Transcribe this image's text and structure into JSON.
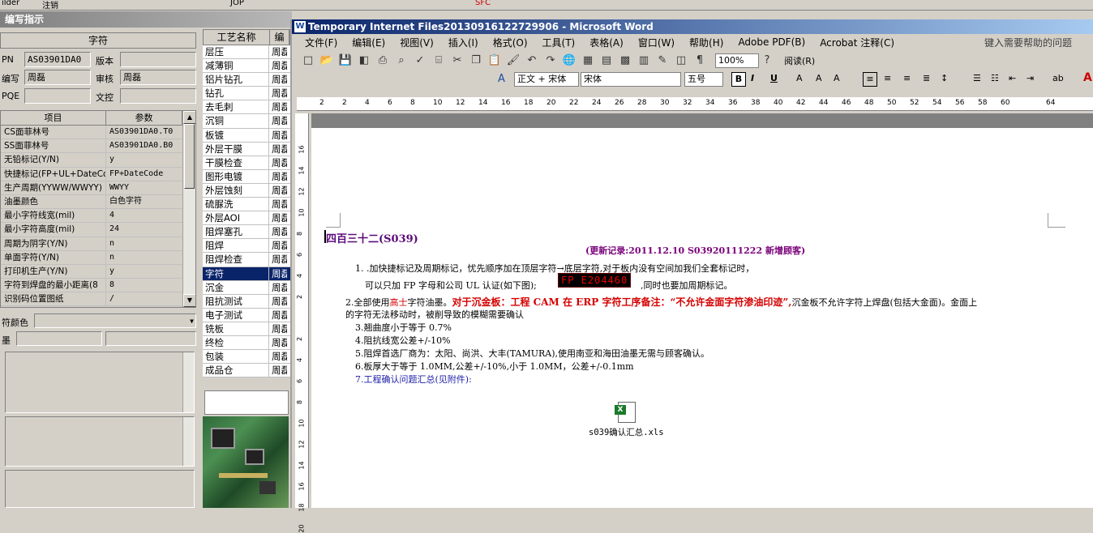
{
  "top_strip": {
    "left_label": "ilder",
    "cancel_label": "注销",
    "jop": "JOP",
    "sfc": "SFC"
  },
  "left_window": {
    "title": "编写指示",
    "section_title": "字符",
    "fields": {
      "pn_label": "PN",
      "pn_value": "AS03901DA0",
      "version_label": "版本",
      "version_value": "",
      "writer_label": "编写",
      "writer_value": "周磊",
      "review_label": "审核",
      "review_value": "周磊",
      "pqe_label": "PQE",
      "pqe_value": "",
      "doc_control_label": "文控",
      "doc_control_value": ""
    },
    "param_table": {
      "headers": [
        "项目",
        "参数"
      ],
      "rows": [
        {
          "item": "CS面菲林号",
          "value": "AS03901DA0.T0"
        },
        {
          "item": "SS面菲林号",
          "value": "AS03901DA0.B0"
        },
        {
          "item": "无铅标记(Y/N)",
          "value": "y"
        },
        {
          "item": "快捷标记(FP+UL+DateCo",
          "value": "FP+DateCode"
        },
        {
          "item": "生产周期(YYWW/WWYY)",
          "value": "WWYY"
        },
        {
          "item": "油墨颜色",
          "value": "白色字符"
        },
        {
          "item": "最小字符线宽(mil)",
          "value": "4"
        },
        {
          "item": "最小字符高度(mil)",
          "value": "24"
        },
        {
          "item": "周期为阴字(Y/N)",
          "value": "n"
        },
        {
          "item": "单面字符(Y/N)",
          "value": "n"
        },
        {
          "item": "打印机生产(Y/N)",
          "value": "y"
        },
        {
          "item": "字符到焊盘的最小距离(8",
          "value": "8"
        },
        {
          "item": "识别码位置图纸",
          "value": "/"
        }
      ]
    },
    "char_color_label": "符颜色",
    "ink_label": "墨"
  },
  "process_list": {
    "headers": [
      "工艺名称",
      "编"
    ],
    "rows": [
      {
        "name": "层压",
        "editor": "周磊"
      },
      {
        "name": "减薄铜",
        "editor": "周磊"
      },
      {
        "name": "铝片钻孔",
        "editor": "周磊"
      },
      {
        "name": "钻孔",
        "editor": "周磊"
      },
      {
        "name": "去毛刺",
        "editor": "周磊"
      },
      {
        "name": "沉铜",
        "editor": "周磊"
      },
      {
        "name": "板镀",
        "editor": "周磊"
      },
      {
        "name": "外层干膜",
        "editor": "周磊"
      },
      {
        "name": "干膜检查",
        "editor": "周磊"
      },
      {
        "name": "图形电镀",
        "editor": "周磊"
      },
      {
        "name": "外层蚀刻",
        "editor": "周磊"
      },
      {
        "name": "硫脲洗",
        "editor": "周磊"
      },
      {
        "name": "外层AOI",
        "editor": "周磊"
      },
      {
        "name": "阻焊塞孔",
        "editor": "周磊"
      },
      {
        "name": "阻焊",
        "editor": "周磊"
      },
      {
        "name": "阻焊检查",
        "editor": "周磊"
      },
      {
        "name": "字符",
        "editor": "周磊"
      },
      {
        "name": "沉金",
        "editor": "周磊"
      },
      {
        "name": "阻抗测试",
        "editor": "周磊"
      },
      {
        "name": "电子测试",
        "editor": "周磊"
      },
      {
        "name": "铣板",
        "editor": "周磊"
      },
      {
        "name": "终检",
        "editor": "周磊"
      },
      {
        "name": "包装",
        "editor": "周磊"
      },
      {
        "name": "成品仓",
        "editor": "周磊"
      }
    ],
    "selected_index": 16
  },
  "word": {
    "title": "Temporary Internet Files20130916122729906 - Microsoft Word",
    "menu": [
      "文件(F)",
      "编辑(E)",
      "视图(V)",
      "插入(I)",
      "格式(O)",
      "工具(T)",
      "表格(A)",
      "窗口(W)",
      "帮助(H)",
      "Adobe PDF(B)",
      "Acrobat 注释(C)"
    ],
    "help_placeholder": "键入需要帮助的问题",
    "zoom": "100%",
    "read_label": "阅读(R)",
    "style": "正文 + 宋体",
    "font": "宋体",
    "size": "五号",
    "ruler_numbers": [
      "2",
      "2",
      "4",
      "6",
      "8",
      "10",
      "12",
      "14",
      "16",
      "18",
      "20",
      "22",
      "24",
      "26",
      "28",
      "30",
      "32",
      "34",
      "36",
      "38",
      "40",
      "42",
      "44",
      "46",
      "48",
      "50",
      "52",
      "54",
      "56",
      "58",
      "60",
      "",
      "64"
    ],
    "vruler_numbers": [
      "16",
      "14",
      "12",
      "10",
      "8",
      "6",
      "4",
      "2",
      "",
      "2",
      "4",
      "6",
      "8",
      "10",
      "12",
      "14",
      "16",
      "18",
      "20"
    ]
  },
  "document": {
    "heading": "四百三十二(S039)",
    "update_line": "(更新记录:2011.12.10        S03920111222      新增顾客)",
    "item1_a": "1. .加快捷标记及周期标记，忧先顺序加在顶层字符→底层字符,对于板内没有空间加我们全套标记时，",
    "item1_b": "可以只加 FP 字母和公司 UL 认证(如下图);",
    "marking": "FP E204460",
    "item1_c": ",同时也要加周期标记。",
    "item2_a": "2.全部使用",
    "item2_b": "高士",
    "item2_c": "字符油墨。",
    "item2_d": "对于沉金板：工程 CAM 在 ERP 字符工序备注：“不允许金面字符渗油印迹”,",
    "item2_e": "沉金板不允许字符上焊盘(包括大金面)。金面上",
    "item2_f": "的字符无法移动时，被削导致的模糊需要确认",
    "item3": "3.翘曲度小于等于 0.7%",
    "item4": "4.阻抗线宽公差+/-10%",
    "item5": "5.阻焊首选厂商为：太阳、尚洪、大丰(TAMURA),使用南亚和海田油墨无需与顾客确认。",
    "item6": "6.板厚大于等于 1.0MM,公差+/-10%,小于 1.0MM，公差+/-0.1mm",
    "item7": "7.工程确认问题汇总(见附件):",
    "attachment": "s039确认汇总.xls"
  }
}
